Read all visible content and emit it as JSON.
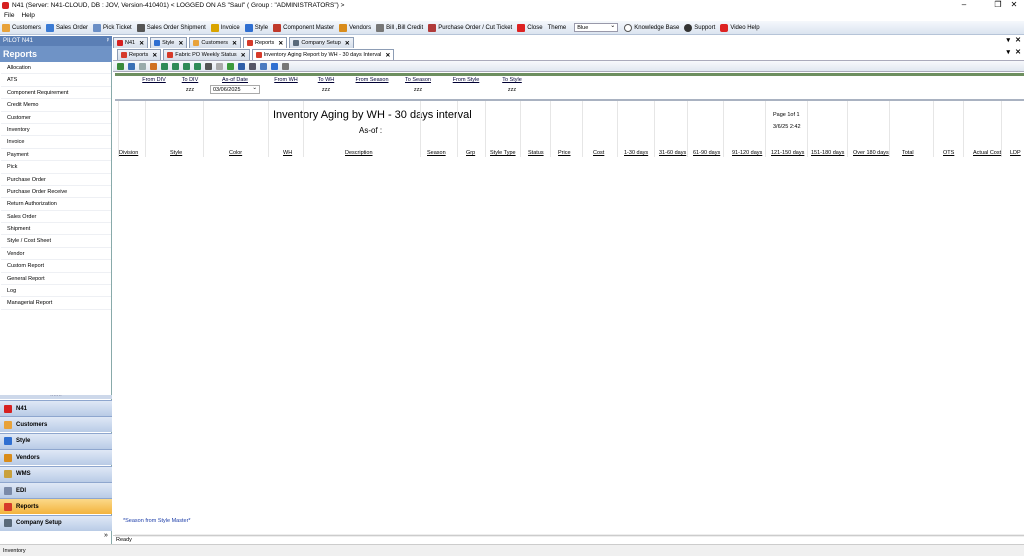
{
  "window": {
    "title": "N41  (Server: N41-CLOUD, DB : JOV, Version-410401)    < LOGGED ON AS \"Saul\" ( Group : \"ADMINISTRATORS\") >"
  },
  "menu": [
    "File",
    "Help"
  ],
  "toolbar": {
    "items": [
      {
        "label": "Customers",
        "icon": "customers-icon",
        "color": "#e8a23a"
      },
      {
        "label": "Sales Order",
        "icon": "sales-order-icon",
        "color": "#3b7bd4"
      },
      {
        "label": "Pick Ticket",
        "icon": "pick-ticket-icon",
        "color": "#6b8fc6"
      },
      {
        "label": "Sales Order Shipment",
        "icon": "shipment-icon",
        "color": "#555"
      },
      {
        "label": "Invoice",
        "icon": "invoice-icon",
        "color": "#d9a400"
      },
      {
        "label": "Style",
        "icon": "style-icon",
        "color": "#2f6fd1"
      },
      {
        "label": "Component Master",
        "icon": "component-icon",
        "color": "#c0392b"
      },
      {
        "label": "Vendors",
        "icon": "vendors-icon",
        "color": "#d98c1b"
      },
      {
        "label": "Bill ,Bill Credit",
        "icon": "bill-icon",
        "color": "#777"
      },
      {
        "label": "Purchase Order / Cut Ticket",
        "icon": "purchase-order-icon",
        "color": "#b03a3a"
      },
      {
        "label": "Close",
        "icon": "close-icon",
        "color": "#d22"
      }
    ],
    "theme_label": "Theme",
    "theme_value": "Blue",
    "knowledge_base": "Knowledge Base",
    "support": "Support",
    "video_help": "Video Help"
  },
  "left": {
    "pilot": "PILOT N41",
    "header": "Reports",
    "items": [
      "Allocation",
      "ATS",
      "Component Requirement",
      "Credit Memo",
      "Customer",
      "Inventory",
      "Invoice",
      "Payment",
      "Pick",
      "Purchase Order",
      "Purchase Order Receive",
      "Return Authorization",
      "Sales Order",
      "Shipment",
      "Style / Cost Sheet",
      "Vendor",
      "Custom Report",
      "General Report",
      "Log",
      "Managerial Report"
    ],
    "nav": [
      {
        "label": "N41",
        "color": "#d62020"
      },
      {
        "label": "Customers",
        "color": "#e8a23a"
      },
      {
        "label": "Style",
        "color": "#2f6fd1"
      },
      {
        "label": "Vendors",
        "color": "#d98c1b"
      },
      {
        "label": "WMS",
        "color": "#c9a13c"
      },
      {
        "label": "EDI",
        "color": "#7a8aa8"
      },
      {
        "label": "Reports",
        "color": "#d63a2a"
      },
      {
        "label": "Company Setup",
        "color": "#5a6a7a"
      }
    ]
  },
  "tabs1": [
    {
      "label": "N41",
      "color": "#d62020"
    },
    {
      "label": "Style",
      "color": "#2f6fd1"
    },
    {
      "label": "Customers",
      "color": "#e8a23a"
    },
    {
      "label": "Reports",
      "color": "#d63a2a"
    },
    {
      "label": "Company Setup",
      "color": "#5a6a7a"
    }
  ],
  "tabs2": [
    {
      "label": "Reports",
      "color": "#d63a2a"
    },
    {
      "label": "Fabric PO Weekly Status",
      "color": "#d63a2a"
    },
    {
      "label": "Inventory Aging Report by WH - 30 days Interval",
      "color": "#d63a2a"
    }
  ],
  "filters": {
    "from_div": {
      "label": "From DIV",
      "value": ""
    },
    "to_div": {
      "label": "To DIV",
      "value": "zzz"
    },
    "as_of_date": {
      "label": "As-of Date",
      "value": "03/06/2025"
    },
    "from_wh": {
      "label": "From WH",
      "value": ""
    },
    "to_wh": {
      "label": "To WH",
      "value": "zzz"
    },
    "from_season": {
      "label": "From Season",
      "value": ""
    },
    "to_season": {
      "label": "To Season",
      "value": "zzz"
    },
    "from_style": {
      "label": "From Style",
      "value": ""
    },
    "to_style": {
      "label": "To Style",
      "value": "zzz"
    }
  },
  "report": {
    "title": "Inventory Aging by WH - 30 days interval",
    "asof": "As-of :",
    "page": "Page 1of 1",
    "date": "3/6/25 2:42",
    "columns": [
      "Division",
      "Style",
      "Color",
      "WH",
      "Description",
      "Season",
      "Grp",
      "Style Type",
      "Status",
      "Price",
      "Cost",
      "1-30 days",
      "31-60 days",
      "61-90 days",
      "91-120 days",
      "121-150 days",
      "151-180 days",
      "Over 180 days",
      "Total",
      "OTS",
      "Actual Cost",
      "LDP"
    ],
    "footnote": "*Season from Style Master*"
  },
  "status": "Ready",
  "bottom": "Inventory"
}
